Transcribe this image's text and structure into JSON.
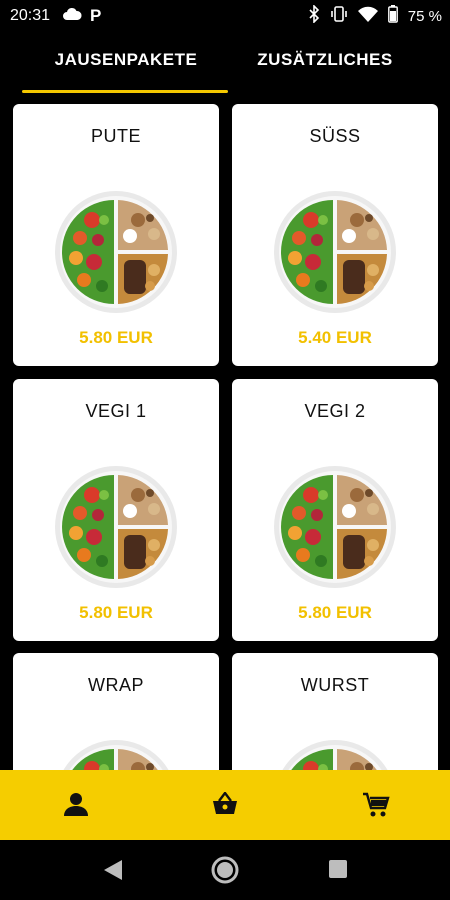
{
  "status": {
    "time": "20:31",
    "battery": "75 %",
    "icons": [
      "cloud-icon",
      "parking-p-icon",
      "bluetooth-icon",
      "vibrate-icon",
      "wifi-icon",
      "battery-icon"
    ],
    "p_label": "P"
  },
  "tabs": [
    {
      "label": "JAUSENPAKETE",
      "active": true
    },
    {
      "label": "ZUSÄTZLICHES",
      "active": false
    }
  ],
  "accent_color": "#f5c800",
  "products": [
    {
      "name": "PUTE",
      "price": "5.80 EUR"
    },
    {
      "name": "SÜSS",
      "price": "5.40 EUR"
    },
    {
      "name": "VEGI 1",
      "price": "5.80 EUR"
    },
    {
      "name": "VEGI 2",
      "price": "5.80 EUR"
    },
    {
      "name": "WRAP",
      "price": ""
    },
    {
      "name": "WURST",
      "price": ""
    }
  ],
  "bottom_nav": [
    "user-icon",
    "basket-icon",
    "cart-icon"
  ],
  "system_nav": [
    "back-icon",
    "home-icon",
    "recents-icon"
  ]
}
